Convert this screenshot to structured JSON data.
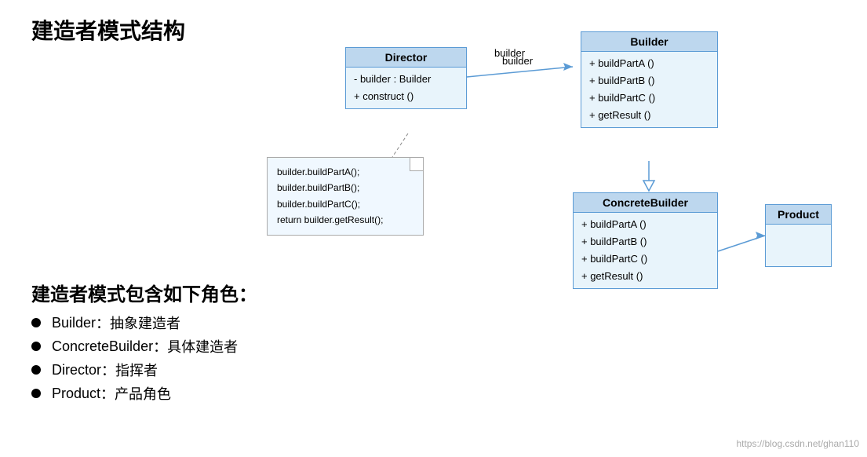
{
  "title": "建造者模式结构",
  "diagram": {
    "director": {
      "name": "Director",
      "attributes": [
        "- builder : Builder"
      ],
      "methods": [
        "+ construct ()"
      ]
    },
    "builder": {
      "name": "Builder",
      "methods": [
        "+ buildPartA ()",
        "+ buildPartB ()",
        "+ buildPartC ()",
        "+ getResult ()"
      ]
    },
    "concreteBuilder": {
      "name": "ConcreteBuilder",
      "methods": [
        "+ buildPartA ()",
        "+ buildPartB ()",
        "+ buildPartC ()",
        "+ getResult ()"
      ]
    },
    "product": {
      "name": "Product"
    },
    "association_label": "builder",
    "note_lines": [
      "builder.buildPartA();",
      "builder.buildPartB();",
      "builder.buildPartC();",
      "return builder.getResult();"
    ]
  },
  "bottom": {
    "title": "建造者模式包含如下角色：",
    "bullets": [
      {
        "term": "Builder",
        "desc": "：抽象建造者"
      },
      {
        "term": "ConcreteBuilder",
        "desc": "：具体建造者"
      },
      {
        "term": "Director",
        "desc": "：指挥者"
      },
      {
        "term": "Product",
        "desc": "：产品角色"
      }
    ]
  },
  "watermark": "https://blog.csdn.net/ghan110"
}
